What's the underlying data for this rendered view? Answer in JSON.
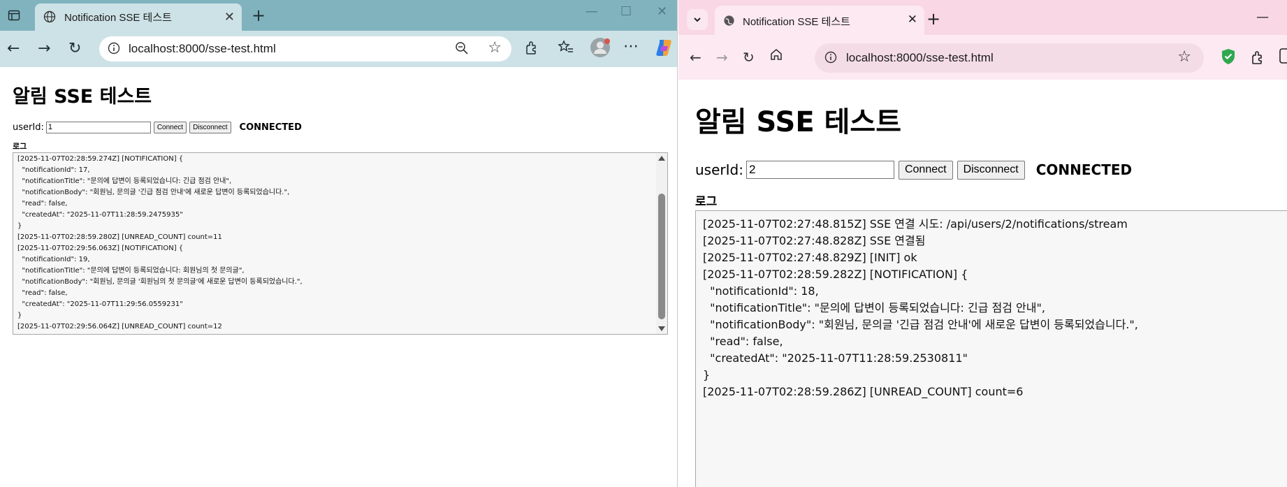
{
  "left_window": {
    "tab": {
      "title": "Notification SSE 테스트"
    },
    "address": {
      "url": "localhost:8000/sse-test.html"
    },
    "page": {
      "title": "알림 SSE 테스트",
      "userid_label": "userId:",
      "userid_value": "1",
      "connect_label": "Connect",
      "disconnect_label": "Disconnect",
      "status": "CONNECTED",
      "log_header": "로그",
      "log_lines": [
        "[2025-11-07T02:28:59.274Z] [NOTIFICATION] {",
        "  \"notificationId\": 17,",
        "  \"notificationTitle\": \"문의에 답변이 등록되었습니다: 긴급 점검 안내\",",
        "  \"notificationBody\": \"회원님, 문의글 '긴급 점검 안내'에 새로운 답변이 등록되었습니다.\",",
        "  \"read\": false,",
        "  \"createdAt\": \"2025-11-07T11:28:59.2475935\"",
        "}",
        "[2025-11-07T02:28:59.280Z] [UNREAD_COUNT] count=11",
        "[2025-11-07T02:29:56.063Z] [NOTIFICATION] {",
        "  \"notificationId\": 19,",
        "  \"notificationTitle\": \"문의에 답변이 등록되었습니다: 회원님의 첫 문의글\",",
        "  \"notificationBody\": \"회원님, 문의글 '회원님의 첫 문의글'에 새로운 답변이 등록되었습니다.\",",
        "  \"read\": false,",
        "  \"createdAt\": \"2025-11-07T11:29:56.0559231\"",
        "}",
        "[2025-11-07T02:29:56.064Z] [UNREAD_COUNT] count=12"
      ]
    },
    "colors": {
      "tabbar": "#81b3bf",
      "toolbar": "#cde2e6"
    }
  },
  "right_window": {
    "tab": {
      "title": "Notification SSE 테스트"
    },
    "address": {
      "url": "localhost:8000/sse-test.html"
    },
    "page": {
      "title": "알림 SSE 테스트",
      "userid_label": "userId:",
      "userid_value": "2",
      "connect_label": "Connect",
      "disconnect_label": "Disconnect",
      "status": "CONNECTED",
      "log_header": "로그",
      "log_lines": [
        "[2025-11-07T02:27:48.815Z] SSE 연결 시도: /api/users/2/notifications/stream",
        "[2025-11-07T02:27:48.828Z] SSE 연결됨",
        "[2025-11-07T02:27:48.829Z] [INIT] ok",
        "[2025-11-07T02:28:59.282Z] [NOTIFICATION] {",
        "  \"notificationId\": 18,",
        "  \"notificationTitle\": \"문의에 답변이 등록되었습니다: 긴급 점검 안내\",",
        "  \"notificationBody\": \"회원님, 문의글 '긴급 점검 안내'에 새로운 답변이 등록되었습니다.\",",
        "  \"read\": false,",
        "  \"createdAt\": \"2025-11-07T11:28:59.2530811\"",
        "}",
        "[2025-11-07T02:28:59.286Z] [UNREAD_COUNT] count=6"
      ]
    },
    "colors": {
      "tabbar": "#f9d7e5",
      "toolbar": "#fce9f1"
    }
  }
}
